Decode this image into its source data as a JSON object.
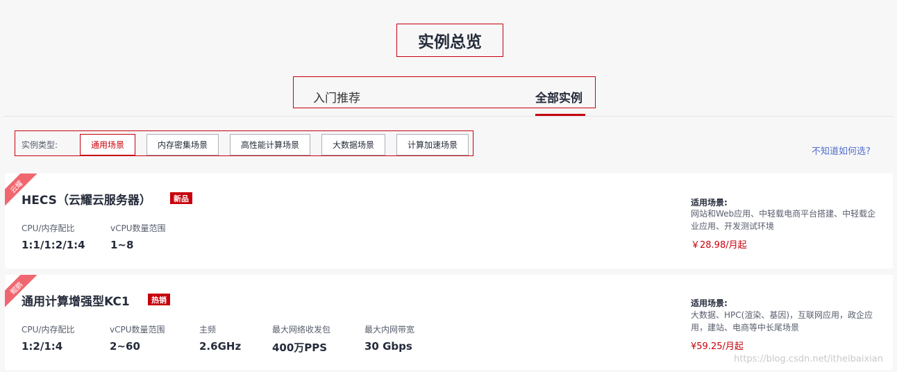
{
  "page": {
    "title": "实例总览",
    "tabs": [
      {
        "label": "入门推荐",
        "active": false
      },
      {
        "label": "全部实例",
        "active": true
      }
    ]
  },
  "filter": {
    "label": "实例类型:",
    "options": [
      {
        "label": "通用场景",
        "active": true
      },
      {
        "label": "内存密集场景",
        "active": false
      },
      {
        "label": "高性能计算场景",
        "active": false
      },
      {
        "label": "大数据场景",
        "active": false
      },
      {
        "label": "计算加速场景",
        "active": false
      }
    ],
    "help_link": "不知道如何选?"
  },
  "cards": [
    {
      "corner_tag": "云耀",
      "title": "HECS（云耀云服务器）",
      "badge": "新品",
      "specs": [
        {
          "label": "CPU/内存配比",
          "value": "1:1/1:2/1:4"
        },
        {
          "label": "vCPU数量范围",
          "value": "1~8"
        }
      ],
      "scenario_title": "适用场景:",
      "scenario_desc": "网站和Web应用、中轻载电商平台搭建、中轻载企业应用、开发测试环境",
      "price": "￥28.98/月起"
    },
    {
      "corner_tag": "鲲鹏",
      "title": "通用计算增强型KC1",
      "badge": "热销",
      "specs": [
        {
          "label": "CPU/内存配比",
          "value": "1:2/1:4"
        },
        {
          "label": "vCPU数量范围",
          "value": "2~60"
        },
        {
          "label": "主频",
          "value": "2.6GHz"
        },
        {
          "label": "最大网络收发包",
          "value": "400万PPS"
        },
        {
          "label": "最大内网带宽",
          "value": "30 Gbps"
        }
      ],
      "scenario_title": "适用场景:",
      "scenario_desc": "大数据、HPC(渲染、基因)，互联网应用，政企应用，建站、电商等中长尾场景",
      "price": "¥59.25/月起"
    }
  ],
  "watermark": "https://blog.csdn.net/itheibaixian",
  "colors": {
    "accent": "#c7000b",
    "link": "#526ecc",
    "corner": "#f0676f"
  }
}
